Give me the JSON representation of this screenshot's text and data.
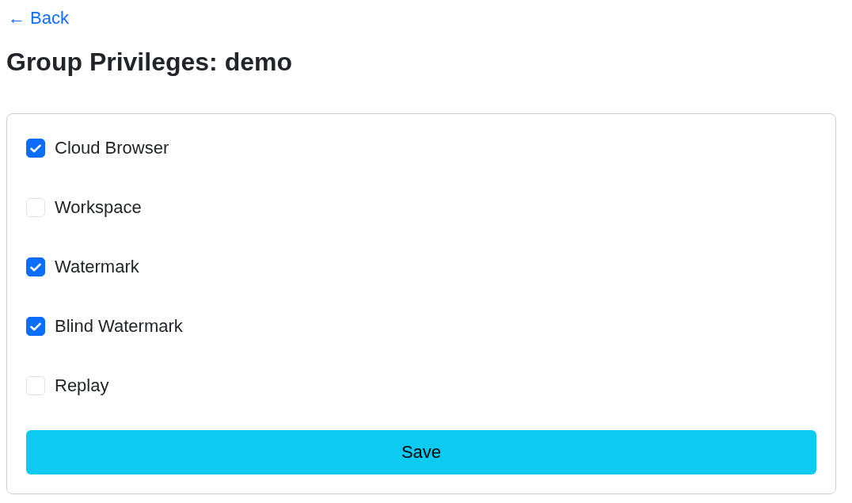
{
  "back_link": {
    "label": "← Back"
  },
  "title": "Group Privileges: demo",
  "privileges": [
    {
      "label": "Cloud Browser",
      "checked": true
    },
    {
      "label": "Workspace",
      "checked": false
    },
    {
      "label": "Watermark",
      "checked": true
    },
    {
      "label": "Blind Watermark",
      "checked": true
    },
    {
      "label": "Replay",
      "checked": false
    }
  ],
  "save_button": {
    "label": "Save"
  }
}
